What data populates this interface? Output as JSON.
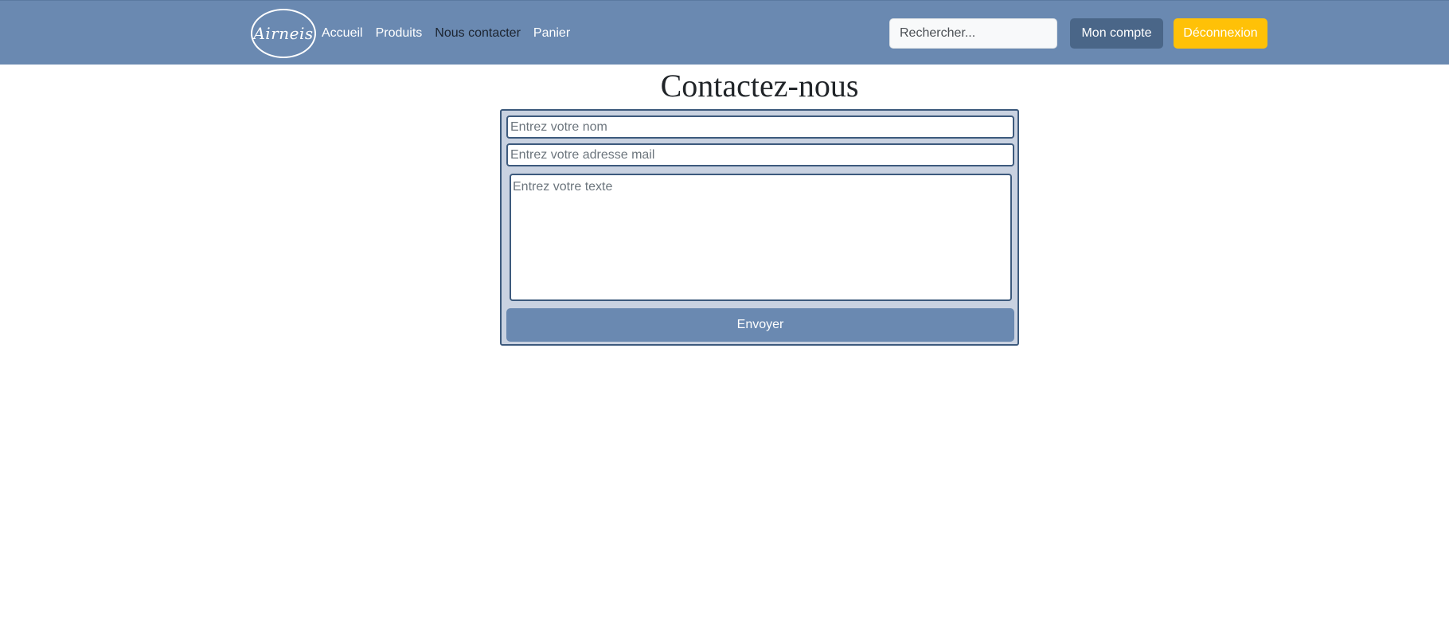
{
  "navbar": {
    "logo_text": "Airneis",
    "links": [
      {
        "label": "Accueil"
      },
      {
        "label": "Produits"
      },
      {
        "label": "Nous contacter"
      },
      {
        "label": "Panier"
      }
    ],
    "search_placeholder": "Rechercher...",
    "account_label": "Mon compte",
    "logout_label": "Déconnexion"
  },
  "main": {
    "title": "Contactez-nous",
    "form": {
      "name_placeholder": "Entrez votre nom",
      "email_placeholder": "Entrez votre adresse mail",
      "message_placeholder": "Entrez votre texte",
      "submit_label": "Envoyer"
    }
  },
  "colors": {
    "navbar_bg": "#6a89b1",
    "account_button": "#4a6688",
    "logout_button": "#ffc107",
    "form_bg": "#c9d2e1",
    "form_border": "#3d5a7d"
  }
}
